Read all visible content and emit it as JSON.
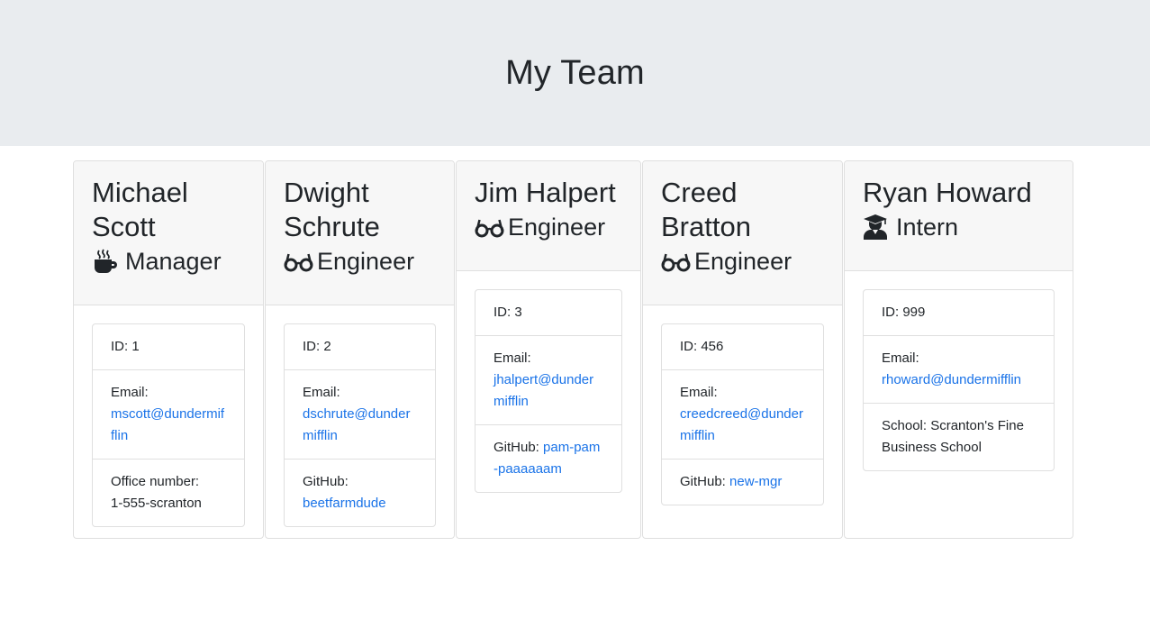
{
  "page": {
    "title": "My Team"
  },
  "colors": {
    "header_bg": "#e9ecef",
    "card_header_bg": "#f7f7f7",
    "link": "#1a73e8",
    "text": "#212529"
  },
  "employees": [
    {
      "name": "Michael Scott",
      "role": "Manager",
      "icon": "mug-icon",
      "id_label": "ID: 1",
      "email_label": "Email:",
      "email": "mscott@dundermifflin",
      "extra_label": "Office number:",
      "extra_value": "1-555-scranton"
    },
    {
      "name": "Dwight Schrute",
      "role": "Engineer",
      "icon": "glasses-icon",
      "id_label": "ID: 2",
      "email_label": "Email:",
      "email": "dschrute@dundermifflin",
      "extra_label": "GitHub:",
      "extra_value": "beetfarmdude"
    },
    {
      "name": "Jim Halpert",
      "role": "Engineer",
      "icon": "glasses-icon",
      "id_label": "ID: 3",
      "email_label": "Email:",
      "email": "jhalpert@dundermifflin",
      "extra_label": "GitHub:",
      "extra_value": "pam-pam-paaaaaam"
    },
    {
      "name": "Creed Bratton",
      "role": "Engineer",
      "icon": "glasses-icon",
      "id_label": "ID: 456",
      "email_label": "Email:",
      "email": "creedcreed@dundermifflin",
      "extra_label": "GitHub:",
      "extra_value": "new-mgr"
    },
    {
      "name": "Ryan Howard",
      "role": "Intern",
      "icon": "graduate-icon",
      "id_label": "ID: 999",
      "email_label": "Email:",
      "email": "rhoward@dundermifflin",
      "extra_label": "School:",
      "extra_value": "Scranton's Fine Business School"
    }
  ]
}
